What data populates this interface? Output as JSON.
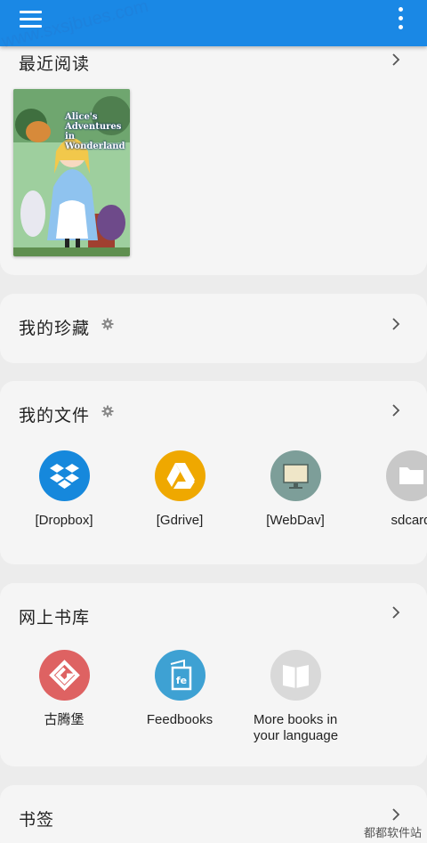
{
  "header": {
    "menu_icon": "hamburger-menu-icon",
    "more_icon": "more-vert-icon"
  },
  "watermark": "www.sxsjbues.com",
  "recent": {
    "title": "最近阅读",
    "book_cover_text": "Alice's Adventures in Wonderland"
  },
  "favorites": {
    "title": "我的珍藏"
  },
  "files": {
    "title": "我的文件",
    "items": [
      {
        "label": "[Dropbox]",
        "color": "#1688dc",
        "icon": "dropbox-icon"
      },
      {
        "label": "[Gdrive]",
        "color": "#efa800",
        "icon": "gdrive-icon"
      },
      {
        "label": "[WebDav]",
        "color": "#7d9e99",
        "icon": "webdav-icon"
      },
      {
        "label": "sdcard",
        "color": "#c8c8c8",
        "icon": "folder-icon"
      }
    ]
  },
  "online": {
    "title": "网上书库",
    "items": [
      {
        "label": "古腾堡",
        "color": "#de6262",
        "icon": "gutenberg-icon"
      },
      {
        "label": "Feedbooks",
        "color": "#3ea1d3",
        "icon": "feedbooks-icon"
      },
      {
        "label_line1": "More books in",
        "label_line2": "your language",
        "color": "#d9d9d9",
        "icon": "open-book-icon"
      }
    ]
  },
  "bookmarks": {
    "title": "书签"
  },
  "corner_brand": "都都软件站"
}
